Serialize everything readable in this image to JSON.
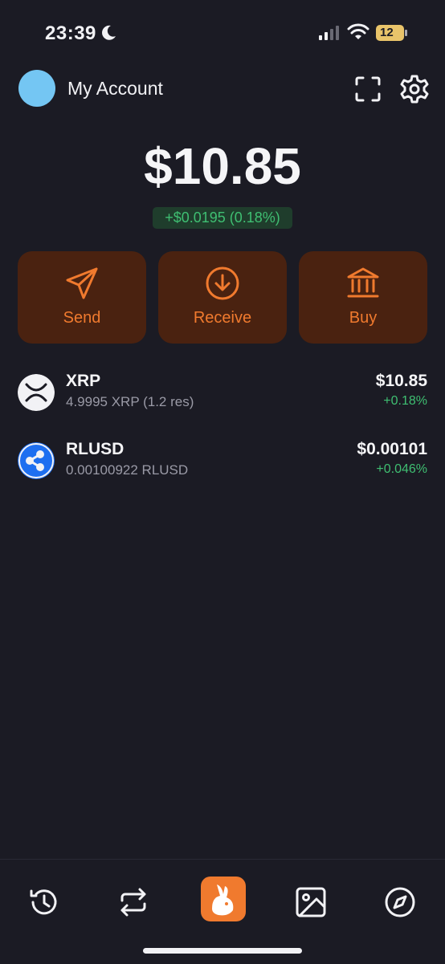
{
  "status": {
    "time": "23:39",
    "battery": "12"
  },
  "header": {
    "account_name": "My Account"
  },
  "balance": {
    "total": "$10.85",
    "change": "+$0.0195 (0.18%)"
  },
  "actions": [
    {
      "label": "Send",
      "icon": "send-icon"
    },
    {
      "label": "Receive",
      "icon": "receive-icon"
    },
    {
      "label": "Buy",
      "icon": "bank-icon"
    }
  ],
  "assets": [
    {
      "name": "XRP",
      "sub": "4.9995 XRP (1.2 res)",
      "value": "$10.85",
      "change": "+0.18%",
      "icon": "xrp-icon"
    },
    {
      "name": "RLUSD",
      "sub": "0.00100922 RLUSD",
      "value": "$0.00101",
      "change": "+0.046%",
      "icon": "ripple-icon"
    }
  ],
  "tabs": [
    "history-icon",
    "swap-icon",
    "home-rabbit-icon",
    "image-gallery-icon",
    "compass-icon"
  ],
  "colors": {
    "accent": "#f07a2e",
    "positive": "#3fbf72",
    "background": "#1b1b24",
    "button_bg": "#4a2210"
  }
}
